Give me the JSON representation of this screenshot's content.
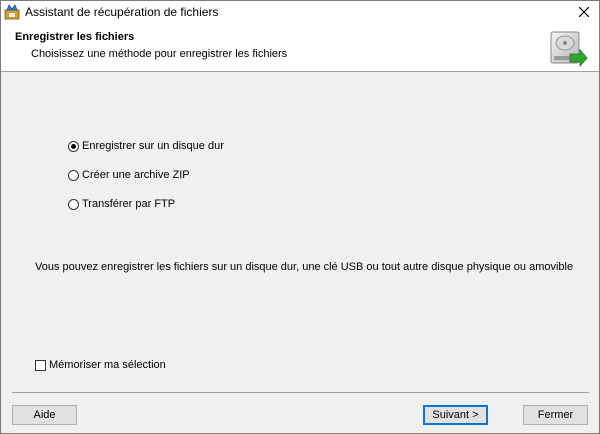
{
  "window": {
    "title": "Assistant de récupération de fichiers"
  },
  "header": {
    "title": "Enregistrer les fichiers",
    "subtitle": "Choisissez une méthode pour enregistrer les fichiers"
  },
  "options": [
    {
      "label": "Enregistrer sur un disque dur",
      "selected": true
    },
    {
      "label": "Créer une archive ZIP",
      "selected": false
    },
    {
      "label": "Transférer par FTP",
      "selected": false
    }
  ],
  "description": "Vous pouvez enregistrer les fichiers sur un disque dur, une clé USB ou tout autre disque physique ou amovible",
  "remember": {
    "label": "Mémoriser ma sélection",
    "checked": false
  },
  "buttons": {
    "help": "Aide",
    "next": "Suivant >",
    "close": "Fermer"
  },
  "colors": {
    "accent": "#0078d7",
    "arrow": "#2fa72f"
  },
  "icons": {
    "app": "recovery-app-icon",
    "header": "hard-drive-save-icon",
    "close": "close-icon"
  }
}
